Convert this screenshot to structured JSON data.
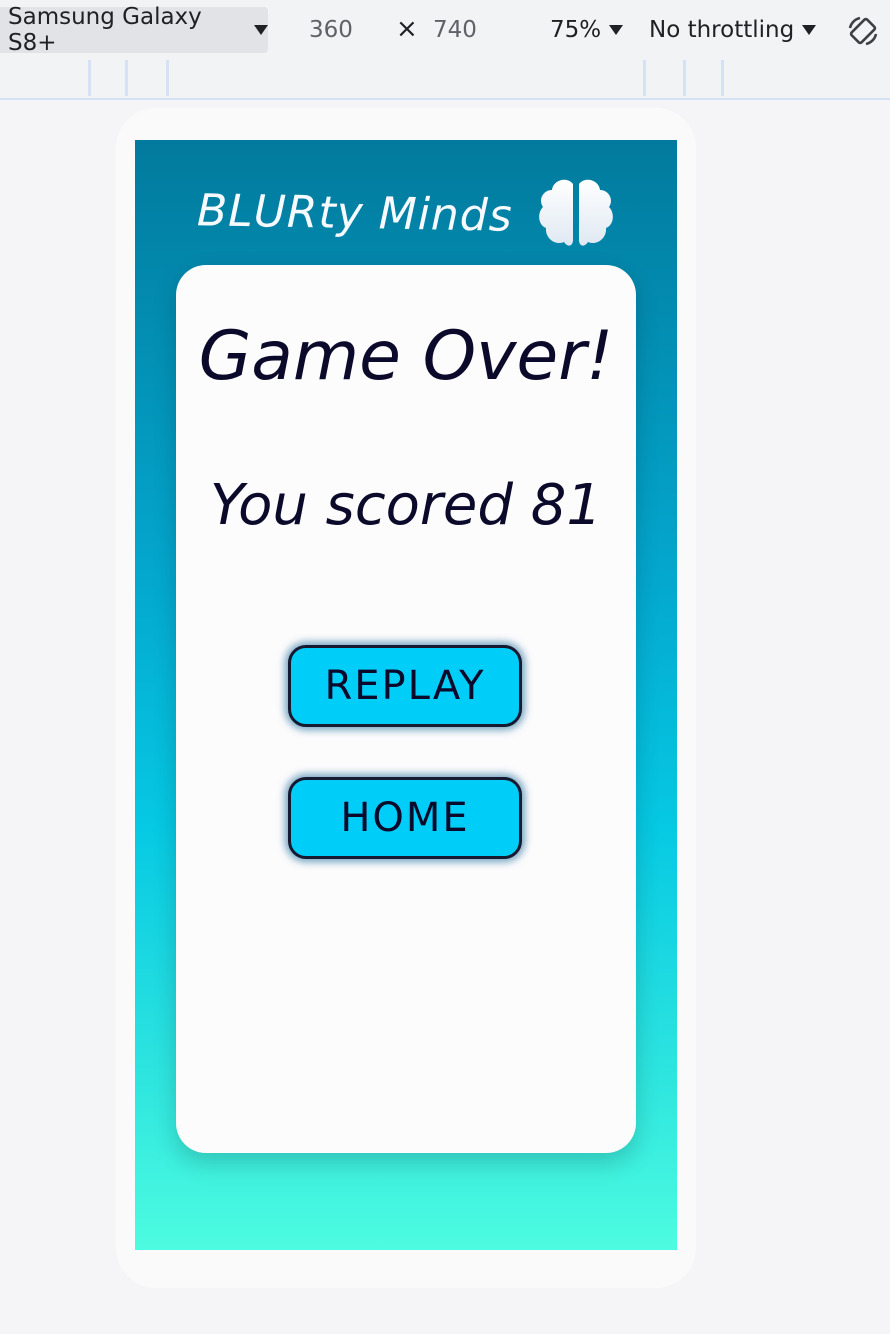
{
  "devtools": {
    "device": "Samsung Galaxy S8+",
    "width": "360",
    "times": "×",
    "height": "740",
    "zoom": "75%",
    "throttling": "No throttling",
    "rotate_icon": "rotate-icon"
  },
  "app": {
    "title": "BLURty Minds",
    "logo_icon": "brain-icon",
    "heading": "Game Over!",
    "score_text": "You scored 81",
    "buttons": {
      "replay": "REPLAY",
      "home": "HOME"
    }
  },
  "colors": {
    "gradient_top": "#027a9d",
    "gradient_bottom": "#4dfce0",
    "button_bg": "#00cdf8",
    "text_dark": "#0c0a2b",
    "card_bg": "#fcfcfd"
  }
}
